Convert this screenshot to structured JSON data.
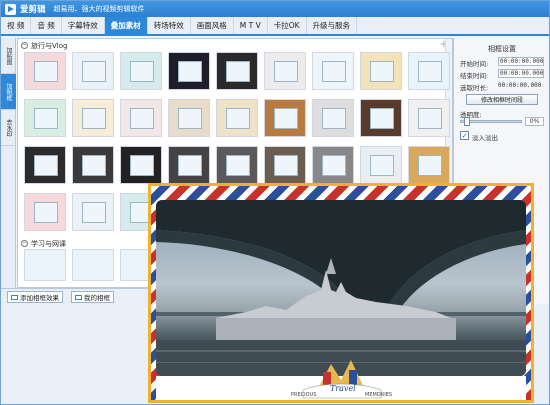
{
  "app": {
    "name": "爱剪辑",
    "slogan": "超易用、强大的视频剪辑软件"
  },
  "menu": {
    "items": [
      "视 频",
      "音 频",
      "字幕特效",
      "叠加素材",
      "转场特效",
      "画面风格",
      "M T V",
      "卡拉OK",
      "升级与服务"
    ],
    "active_index": 3
  },
  "sidetabs": [
    "加贴图",
    "加相框",
    "去水印"
  ],
  "gallery": {
    "group1_title": "旅行与Vlog",
    "group2_title": "学习与网课"
  },
  "bottom_buttons": {
    "add_frame": "添加相框效果",
    "my_frames": "我的相框"
  },
  "panel": {
    "title": "相框设置",
    "start_label": "开始时间:",
    "start_value": "00:00:00.000",
    "end_label": "结束时间:",
    "end_value": "00:00:00.000",
    "duration_label": "选取时长:",
    "duration_value": "00:00:00.000",
    "modify_button": "修改相框时间段",
    "opacity_label": "透明度:",
    "opacity_value": "0%",
    "fade_label": "淡入淡出",
    "fade_checked": true
  },
  "preview": {
    "stamp_text_left": "PRECIOUS",
    "stamp_text_right": "MEMORIES",
    "stamp_script": "Travel"
  },
  "colors": {
    "accent": "#2f87d8",
    "preview_border": "#f0b12f",
    "airmail_red": "#c8322e",
    "airmail_blue": "#2a4f9c"
  }
}
